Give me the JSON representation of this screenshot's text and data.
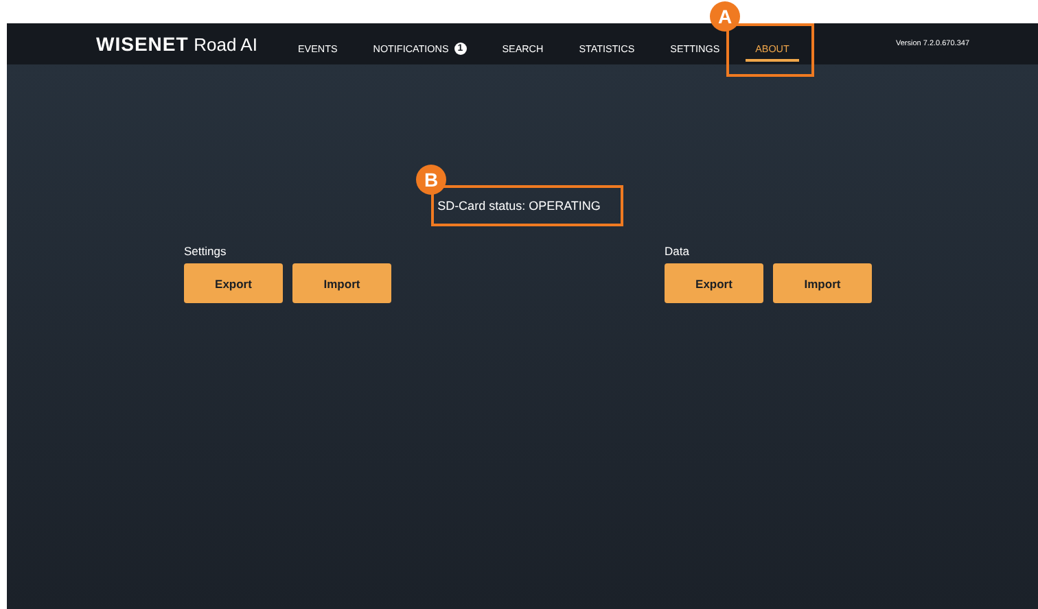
{
  "nav": {
    "logo_brand": "WISENET",
    "logo_product": "Road AI",
    "items": [
      {
        "label": "EVENTS",
        "selected": false
      },
      {
        "label": "NOTIFICATIONS",
        "selected": false,
        "badge": "1"
      },
      {
        "label": "SEARCH",
        "selected": false
      },
      {
        "label": "STATISTICS",
        "selected": false
      },
      {
        "label": "SETTINGS",
        "selected": false
      },
      {
        "label": "ABOUT",
        "selected": true
      }
    ],
    "version": "Version 7.2.0.670.347"
  },
  "status": "SD-Card status: OPERATING",
  "groups": [
    {
      "title": "Settings",
      "buttons": [
        "Export",
        "Import"
      ]
    },
    {
      "title": "Data",
      "buttons": [
        "Export",
        "Import"
      ]
    }
  ],
  "annotations": [
    "A",
    "B"
  ]
}
